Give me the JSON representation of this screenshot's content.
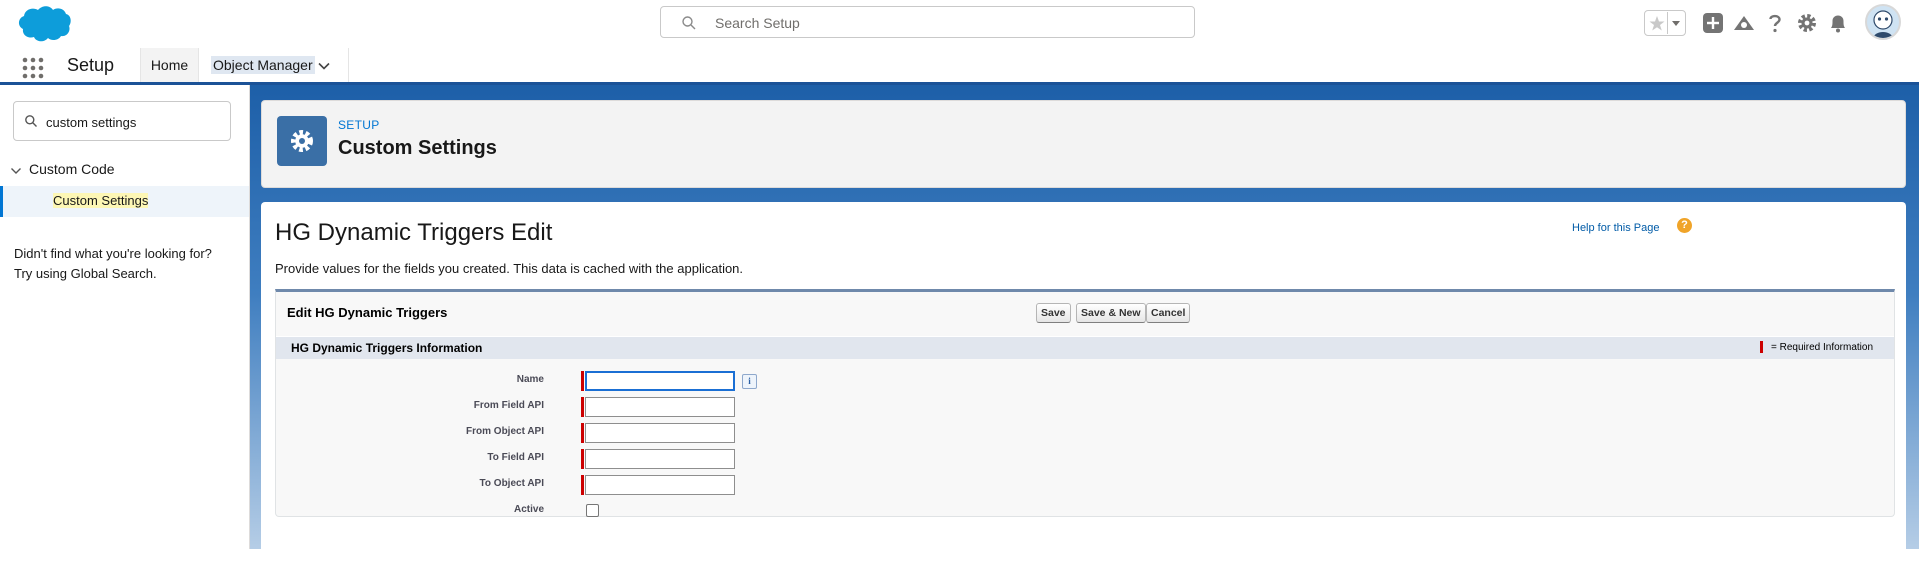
{
  "header": {
    "search_placeholder": "Search Setup"
  },
  "context_bar": {
    "app_name": "Setup",
    "tabs": [
      {
        "label": "Home"
      },
      {
        "label": "Object Manager"
      }
    ]
  },
  "sidebar": {
    "quickfind_value": "custom settings",
    "tree": {
      "node_label": "Custom Code",
      "leaf_label": "Custom Settings"
    },
    "help_line1": "Didn't find what you're looking for?",
    "help_line2": "Try using Global Search."
  },
  "page_header": {
    "eyebrow": "SETUP",
    "title": "Custom Settings"
  },
  "content": {
    "title": "HG Dynamic Triggers Edit",
    "help_link": "Help for this Page",
    "help_q": "?",
    "description": "Provide values for the fields you created. This data is cached with the application.",
    "block_title": "Edit HG Dynamic Triggers",
    "buttons": {
      "save": "Save",
      "save_new": "Save & New",
      "cancel": "Cancel"
    },
    "section_title": "HG Dynamic Triggers Information",
    "required_info": "= Required Information",
    "info_icon": "i",
    "fields": [
      {
        "label": "Name",
        "value": ""
      },
      {
        "label": "From Field API",
        "value": ""
      },
      {
        "label": "From Object API",
        "value": ""
      },
      {
        "label": "To Field API",
        "value": ""
      },
      {
        "label": "To Object API",
        "value": ""
      },
      {
        "label": "Active",
        "checked": false
      }
    ]
  },
  "colors": {
    "brand": "#0176d3",
    "required": "#cc0000",
    "header_blue": "#1b5297"
  }
}
